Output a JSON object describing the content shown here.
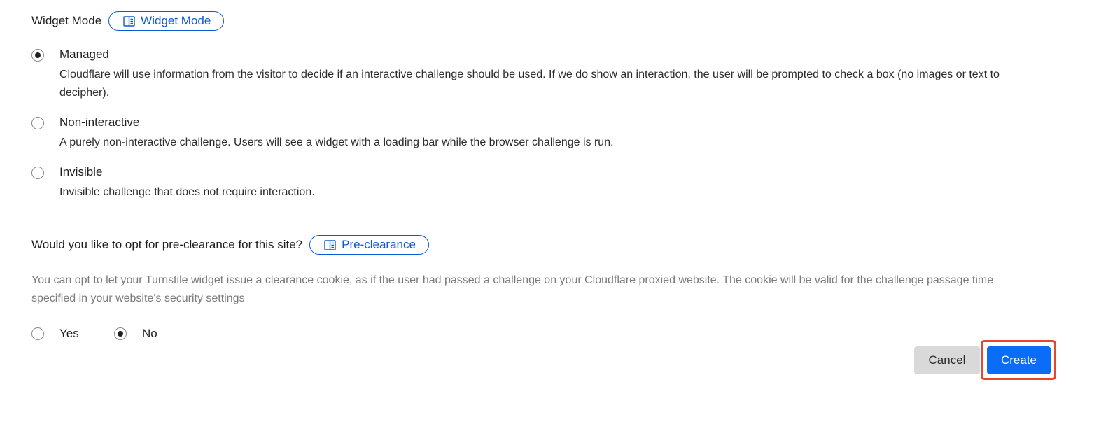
{
  "widget_mode": {
    "label": "Widget Mode",
    "doc_link_label": "Widget Mode",
    "options": [
      {
        "title": "Managed",
        "description": "Cloudflare will use information from the visitor to decide if an interactive challenge should be used. If we do show an interaction, the user will be prompted to check a box (no images or text to decipher).",
        "checked": true
      },
      {
        "title": "Non-interactive",
        "description": "A purely non-interactive challenge. Users will see a widget with a loading bar while the browser challenge is run.",
        "checked": false
      },
      {
        "title": "Invisible",
        "description": "Invisible challenge that does not require interaction.",
        "checked": false
      }
    ]
  },
  "pre_clearance": {
    "label": "Would you like to opt for pre-clearance for this site?",
    "doc_link_label": "Pre-clearance",
    "helper": "You can opt to let your Turnstile widget issue a clearance cookie, as if the user had passed a challenge on your Cloudflare proxied website. The cookie will be valid for the challenge passage time specified in your website's security settings",
    "options": [
      {
        "label": "Yes",
        "checked": false
      },
      {
        "label": "No",
        "checked": true
      }
    ]
  },
  "actions": {
    "cancel_label": "Cancel",
    "create_label": "Create"
  },
  "colors": {
    "link_blue": "#0a5bd3",
    "primary_button": "#0b6cf5",
    "cancel_button": "#d9d9d9",
    "highlight": "#e8442e"
  },
  "icons": {
    "doc_link": "book-icon"
  }
}
